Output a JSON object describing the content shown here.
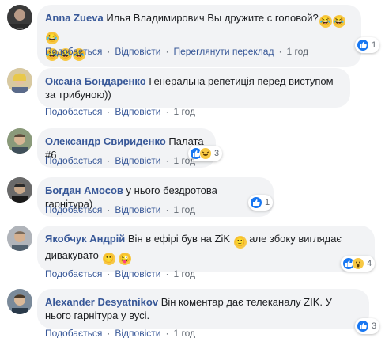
{
  "comments": [
    {
      "author": "Anna Zueva",
      "text": "Илья Владимирович Вы дружите с головой?",
      "actions": {
        "like": "Подобається",
        "reply": "Відповісти",
        "translate": "Переглянути переклад",
        "time": "1 год"
      },
      "reaction_count": "1",
      "reactions": [
        "like"
      ]
    },
    {
      "author": "Оксана Бондаренко",
      "text": "Генеральна репетиція перед виступом за трибуною))",
      "actions": {
        "like": "Подобається",
        "reply": "Відповісти",
        "time": "1 год"
      }
    },
    {
      "author": "Олександр Свириденко",
      "text": "Палата #6",
      "actions": {
        "like": "Подобається",
        "reply": "Відповісти",
        "time": "1 год"
      },
      "reaction_count": "3",
      "reactions": [
        "like",
        "haha"
      ]
    },
    {
      "author": "Богдан Амосов",
      "text": "у нього бездротова гарнітура)",
      "actions": {
        "like": "Подобається",
        "reply": "Відповісти",
        "time": "1 год"
      },
      "reaction_count": "1",
      "reactions": [
        "like"
      ]
    },
    {
      "author": "Якобчук Андрій",
      "text_part1": "Він в ефірі був на ZiK",
      "text_part2": "але збоку виглядає",
      "text_part3": "дивакувато",
      "actions": {
        "like": "Подобається",
        "reply": "Відповісти",
        "time": "1 год"
      },
      "reaction_count": "4",
      "reactions": [
        "like",
        "wow"
      ]
    },
    {
      "author": "Alexander Desyatnikov",
      "text": "Він коментар дає телеканалу ZIK. У нього гарнітура у вусі.",
      "actions": {
        "like": "Подобається",
        "reply": "Відповісти",
        "time": "1 год"
      },
      "reaction_count": "3",
      "reactions": [
        "like"
      ]
    }
  ],
  "separator": "·",
  "colors": {
    "link": "#385898",
    "meta": "#606770",
    "bubble": "#f2f3f5",
    "like_blue": "#1877f2"
  },
  "icons": [
    "laughing-emoji-icon",
    "smile-emoji-icon",
    "tongue-wink-emoji-icon",
    "like-reaction-icon",
    "haha-reaction-icon",
    "wow-reaction-icon"
  ]
}
